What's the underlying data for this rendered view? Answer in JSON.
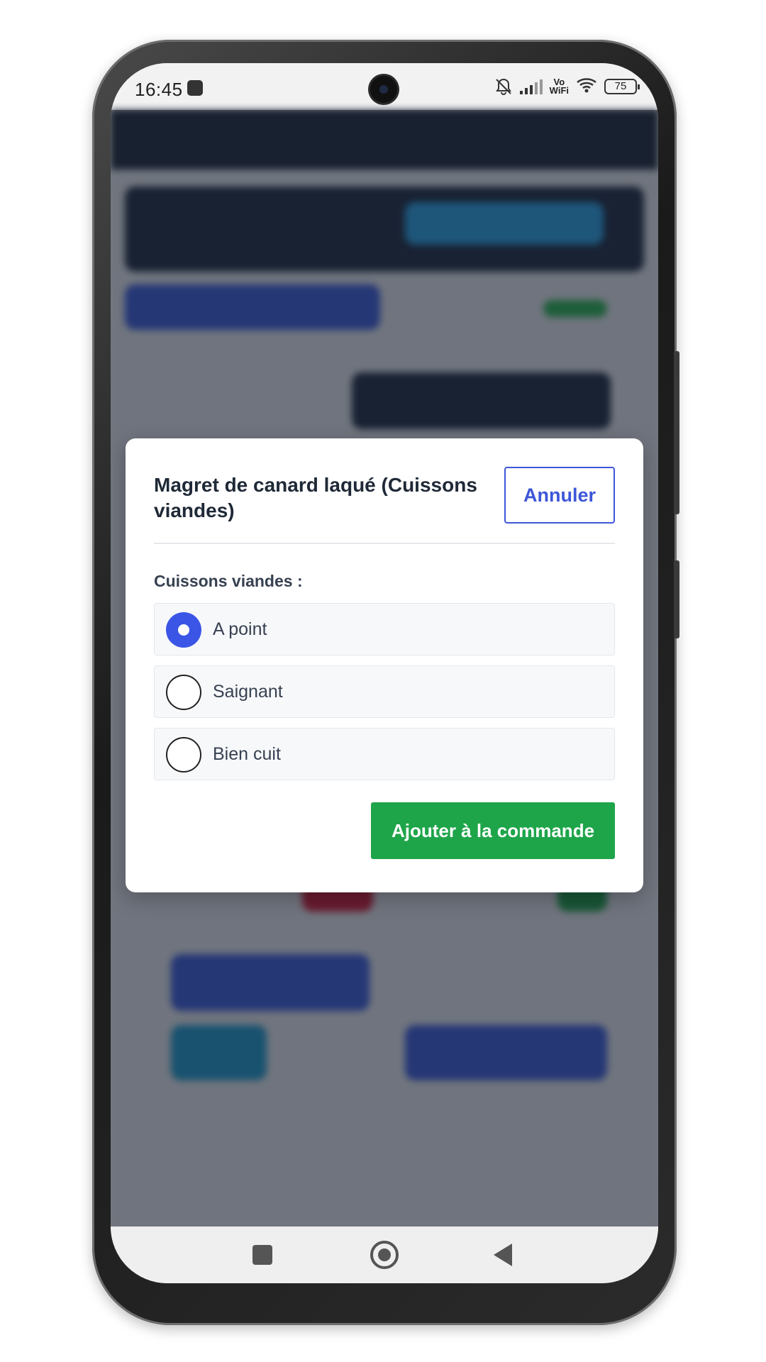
{
  "status_bar": {
    "time": "16:45",
    "network_label": "Vo\nWiFi",
    "battery": "75"
  },
  "modal": {
    "title": "Magret de canard laqué (Cuissons viandes)",
    "cancel_label": "Annuler",
    "section_label": "Cuissons viandes :",
    "options": [
      {
        "label": "A point",
        "selected": true
      },
      {
        "label": "Saignant",
        "selected": false
      },
      {
        "label": "Bien cuit",
        "selected": false
      }
    ],
    "submit_label": "Ajouter à la commande"
  },
  "colors": {
    "accent_blue": "#3b55e6",
    "submit_green": "#1ea54a"
  },
  "icons": {
    "status": [
      "notifications-off-icon",
      "signal-icon",
      "vowifi-icon",
      "wifi-icon",
      "battery-icon"
    ],
    "nav": [
      "recents-icon",
      "home-icon",
      "back-icon"
    ]
  }
}
